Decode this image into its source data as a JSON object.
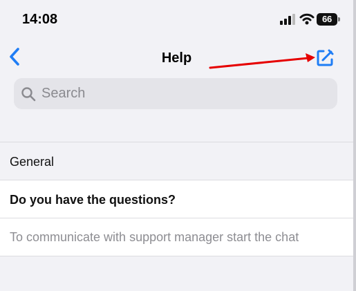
{
  "status_bar": {
    "time": "14:08",
    "battery": "66",
    "icons": [
      "signal-icon",
      "wifi-icon",
      "battery-icon"
    ]
  },
  "nav": {
    "title": "Help",
    "back_icon": "chevron-left-icon",
    "compose_icon": "compose-icon"
  },
  "search": {
    "placeholder": "Search",
    "value": ""
  },
  "section": {
    "title": "General"
  },
  "items": [
    {
      "label": "Do you have the questions?"
    },
    {
      "label": "To communicate with support manager start the chat"
    }
  ],
  "colors": {
    "accent": "#1f7df5",
    "background": "#f2f2f6",
    "row_background": "#ffffff",
    "annotation": "#e60000"
  }
}
